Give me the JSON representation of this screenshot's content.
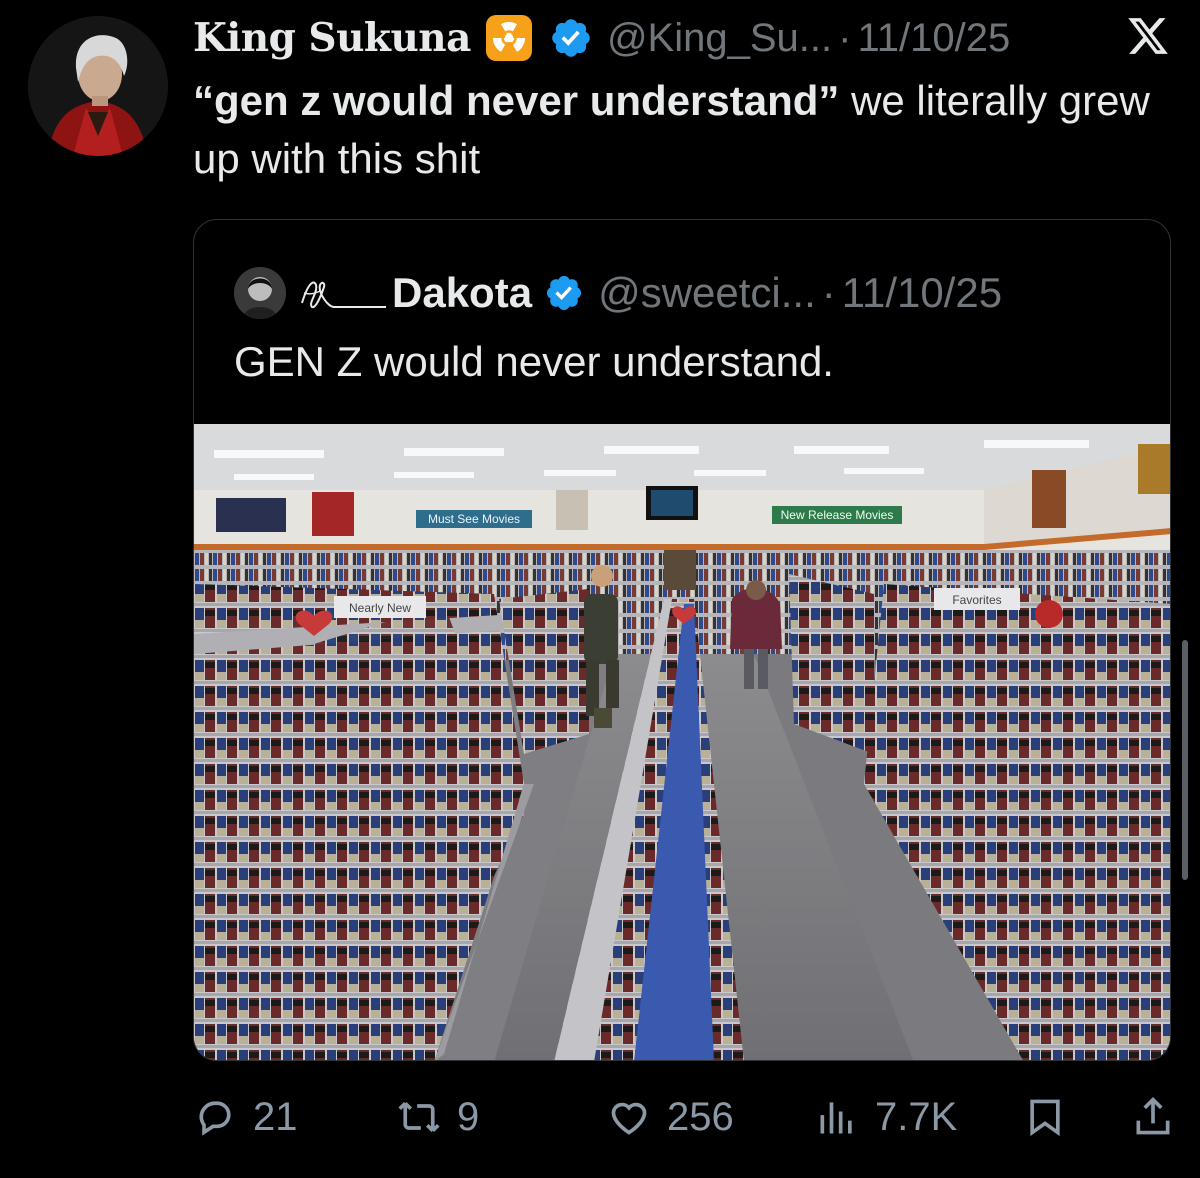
{
  "tweet": {
    "author_name": "King Sukuna",
    "handle": "@King_Su...",
    "separator": "·",
    "date": "11/10/25",
    "text_bold": "“gen z would never understand”",
    "text_rest": " we literally grew up with this shit"
  },
  "quote": {
    "author_name": "Dakota",
    "handle": "@sweetci...",
    "separator": "·",
    "date": "11/10/25",
    "text": "GEN Z would never understand.",
    "photo": {
      "sign_left": "Must See Movies",
      "sign_right": "New Release Movies",
      "shelf_tag_1": "Nearly New",
      "shelf_tag_2": "Favorites"
    }
  },
  "actions": {
    "replies": "21",
    "reposts": "9",
    "likes": "256",
    "views": "7.7K"
  },
  "icons": {
    "platform_logo": "x-logo-icon",
    "verified": "verified-badge-icon",
    "emoji": "radiation-icon"
  },
  "colors": {
    "background": "#000000",
    "text": "#e7e9ea",
    "muted": "#71767b",
    "verified_blue": "#1d9bf0",
    "radiation_orange": "#f7a01a"
  }
}
